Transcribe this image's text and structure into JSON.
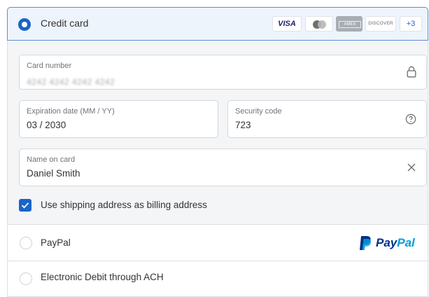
{
  "credit_card": {
    "label": "Credit card",
    "selected": true,
    "brands": {
      "visa": "VISA",
      "mastercard": "mastercard-logo",
      "amex": "AMEX",
      "discover": "DISCOVER",
      "more": "+3"
    }
  },
  "fields": {
    "card_number": {
      "label": "Card number",
      "value": "4242 4242 4242 4242",
      "icon": "lock-icon"
    },
    "expiration": {
      "label": "Expiration date (MM / YY)",
      "value": "03 / 2030"
    },
    "security_code": {
      "label": "Security code",
      "value": "723",
      "icon": "help-circle-icon"
    },
    "name_on_card": {
      "label": "Name on card",
      "value": "Daniel Smith",
      "icon": "clear-icon"
    }
  },
  "billing": {
    "label": "Use shipping address as billing address",
    "checked": true
  },
  "options": {
    "paypal": {
      "label": "PayPal",
      "logo_pay": "Pay",
      "logo_pal": "Pal"
    },
    "ach": {
      "label": "Electronic Debit through ACH"
    }
  },
  "colors": {
    "accent": "#1b64c8",
    "header_bg": "#eef4fb",
    "body_bg": "#f4f5f6",
    "paypal_dark": "#003087",
    "paypal_light": "#009cde"
  }
}
